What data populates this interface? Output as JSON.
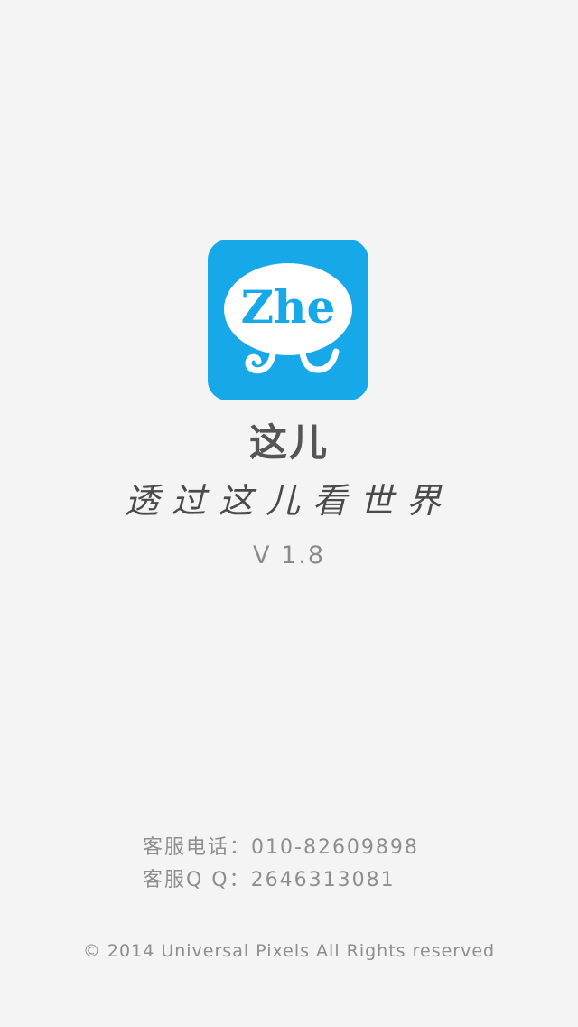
{
  "app": {
    "logo_text": "Zhe",
    "name": "这儿",
    "slogan": "透过这儿看世界",
    "version": "V 1.8",
    "accent_color": "#17a8e9"
  },
  "contact": {
    "phone_label": "客服电话：",
    "phone_value": "010-82609898",
    "qq_label": "客服Q Q：",
    "qq_value": "2646313081"
  },
  "footer": {
    "copyright_icon": "copyright-symbol",
    "copyright_text": "© 2014 Universal Pixels All Rights reserved"
  }
}
